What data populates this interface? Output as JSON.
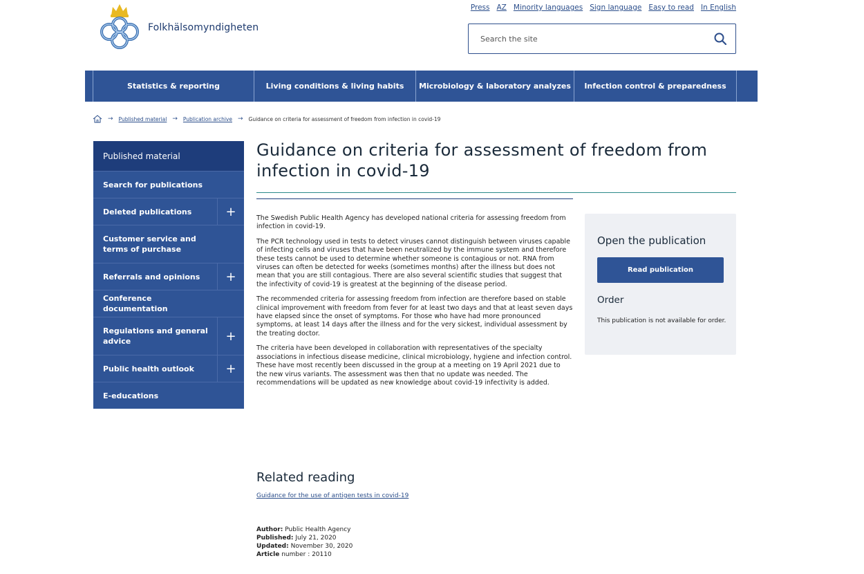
{
  "header": {
    "logo_text": "Folkhälsomyndigheten",
    "top_links": [
      "Press",
      "AZ",
      "Minority languages",
      "Sign language",
      "Easy to read",
      "In English"
    ],
    "search_placeholder": "Search the site"
  },
  "nav": {
    "items": [
      "Statistics & reporting",
      "Living conditions & living habits",
      "Microbiology & laboratory analyzes",
      "Infection control & preparedness"
    ]
  },
  "breadcrumb": {
    "items": [
      "Published material",
      "Publication archive",
      "Guidance on criteria for assessment of freedom from infection in covid-19"
    ]
  },
  "sidebar": {
    "heading": "Published material",
    "items": [
      {
        "label": "Search for publications",
        "expandable": false
      },
      {
        "label": "Deleted publications",
        "expandable": true
      },
      {
        "label": "Customer service and terms of purchase",
        "expandable": false
      },
      {
        "label": "Referrals and opinions",
        "expandable": true
      },
      {
        "label": "Conference documentation",
        "expandable": false
      },
      {
        "label": "Regulations and general advice",
        "expandable": true
      },
      {
        "label": "Public health outlook",
        "expandable": true
      },
      {
        "label": "E-educations",
        "expandable": false
      }
    ],
    "plus_glyph": "+"
  },
  "main": {
    "title": "Guidance on criteria for assessment of freedom from infection in covid-19",
    "paragraphs": [
      "The Swedish Public Health Agency has developed national criteria for assessing freedom from infection in covid-19.",
      "The PCR technology used in tests to detect viruses cannot distinguish between viruses capable of infecting cells and viruses that have been neutralized by the immune system and therefore these tests cannot be used to determine whether someone is contagious or not. RNA from viruses can often be detected for weeks (sometimes months) after the illness but does not mean that you are still contagious. There are also several scientific studies that suggest that the infectivity of covid-19 is greatest at the beginning of the disease period.",
      "The recommended criteria for assessing freedom from infection are therefore based on stable clinical improvement with freedom from fever for at least two days and that at least seven days have elapsed since the onset of symptoms. For those who have had more pronounced symptoms, at least 14 days after the illness and for the very sickest, individual assessment by the treating doctor.",
      "The criteria have been developed in collaboration with representatives of the specialty associations in infectious disease medicine, clinical microbiology, hygiene and infection control. These have most recently been discussed in the group at a meeting on 19 April 2021 due to the new virus variants. The assessment was then that no update was needed. The recommendations will be updated as new knowledge about covid-19 infectivity is added."
    ],
    "related_title": "Related reading",
    "related_link": "Guidance for the use of antigen tests in covid-19",
    "meta": {
      "author_label": "Author:",
      "author": "Public Health Agency",
      "published_label": "Published:",
      "published": "July 21, 2020",
      "updated_label": "Updated:",
      "updated": "November 30, 2020",
      "article_label": "Article",
      "article": "number : 20110"
    }
  },
  "publication_box": {
    "title": "Open the publication",
    "button": "Read publication",
    "order_title": "Order",
    "order_text": "This publication is not available for order."
  },
  "colors": {
    "brand_blue": "#2f5496",
    "dark_blue": "#1e3d7b",
    "teal_rule": "#2a8a8a",
    "logo_blue": "#3a6fb0",
    "crown_gold": "#e8b923"
  }
}
